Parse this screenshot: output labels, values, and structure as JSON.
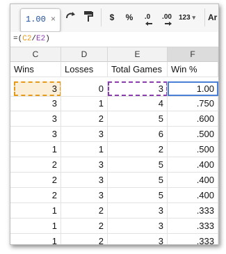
{
  "toolbar": {
    "redo_icon": "redo-icon",
    "paint_icon": "paint-format-icon",
    "currency": "$",
    "percent": "%",
    "decrease_decimals": ".0",
    "increase_decimals": ".00",
    "more_formats": "123",
    "more_formats_arrow": "▾",
    "font_partial": "Ar"
  },
  "tooltip": {
    "value": "1.00",
    "close": "×"
  },
  "formula": {
    "eq": "=",
    "lparen": "(",
    "ref1": "C2",
    "slash": "/",
    "ref2": "E2",
    "rparen": ")"
  },
  "columns": [
    "C",
    "D",
    "E",
    "F"
  ],
  "headers": {
    "wins": "Wins",
    "losses": "Losses",
    "total": "Total Games",
    "pct": "Win %"
  },
  "rows": [
    {
      "wins": "3",
      "losses": "0",
      "total": "3",
      "pct": "1.00"
    },
    {
      "wins": "3",
      "losses": "1",
      "total": "4",
      "pct": ".750"
    },
    {
      "wins": "3",
      "losses": "2",
      "total": "5",
      "pct": ".600"
    },
    {
      "wins": "3",
      "losses": "3",
      "total": "6",
      "pct": ".500"
    },
    {
      "wins": "1",
      "losses": "1",
      "total": "2",
      "pct": ".500"
    },
    {
      "wins": "2",
      "losses": "3",
      "total": "5",
      "pct": ".400"
    },
    {
      "wins": "2",
      "losses": "3",
      "total": "5",
      "pct": ".400"
    },
    {
      "wins": "2",
      "losses": "3",
      "total": "5",
      "pct": ".400"
    },
    {
      "wins": "1",
      "losses": "2",
      "total": "3",
      "pct": ".333"
    },
    {
      "wins": "1",
      "losses": "2",
      "total": "3",
      "pct": ".333"
    },
    {
      "wins": "1",
      "losses": "2",
      "total": "3",
      "pct": ".333"
    }
  ],
  "colors": {
    "ref_orange": "#e69a1a",
    "ref_purple": "#8a3cb0",
    "selection_blue": "#4a7fd6"
  }
}
